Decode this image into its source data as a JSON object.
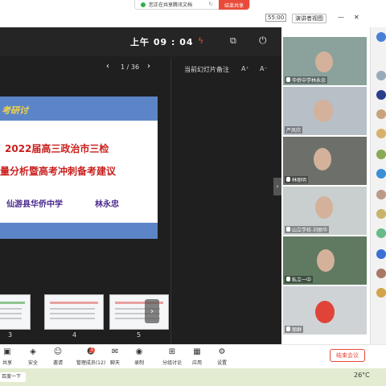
{
  "share_bar": {
    "status": "您正在共享腾讯文档",
    "stop_label": "结束共享"
  },
  "presenter": {
    "timer": "55:00",
    "view_label": "演讲者视图",
    "clock": "上午 09 : 04",
    "slide_counter": "1 / 36",
    "notes_title": "当前幻灯片备注",
    "font_up": "A⁺",
    "font_down": "A⁻"
  },
  "slide": {
    "banner": "考研讨",
    "line1": "2022届高三政治市三检",
    "line2": "量分析暨高考冲刺备考建议",
    "school": "仙游县华侨中学",
    "teacher": "林永忠"
  },
  "thumbnails": [
    {
      "number": "3"
    },
    {
      "number": "4"
    },
    {
      "number": "5"
    }
  ],
  "participants": [
    {
      "name": "华侨中学林永忠"
    },
    {
      "name": "严凤欣"
    },
    {
      "name": "林丽明"
    },
    {
      "name": "山立学校-刘丽华"
    },
    {
      "name": "私立一中"
    },
    {
      "name": "丽群"
    }
  ],
  "toolbar": [
    {
      "icon": "share-icon",
      "label": "共享"
    },
    {
      "icon": "shield-icon",
      "label": "安全"
    },
    {
      "icon": "invite-icon",
      "label": "邀请"
    },
    {
      "icon": "members-icon",
      "label": "管理成员(12)"
    },
    {
      "icon": "chat-icon",
      "label": "聊天"
    },
    {
      "icon": "record-icon",
      "label": "录制"
    },
    {
      "icon": "breakout-icon",
      "label": "分组讨论"
    },
    {
      "icon": "apps-icon",
      "label": "应用"
    },
    {
      "icon": "settings-icon",
      "label": "设置"
    }
  ],
  "members_badge": "1",
  "end_meeting_label": "结束会议",
  "taskbar": {
    "search_placeholder": "百度一下",
    "weather": "26°C"
  },
  "colors": {
    "brand_blue": "#5b85c6",
    "title_red": "#c8201e",
    "name_purple": "#4a2a8c",
    "danger": "#e84b3a"
  }
}
